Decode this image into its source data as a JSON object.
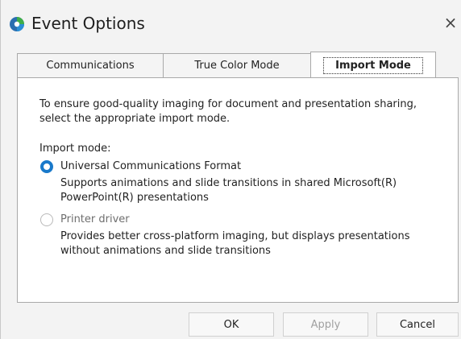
{
  "window": {
    "title": "Event Options",
    "close_glyph": "×"
  },
  "tabs": [
    {
      "label": "Communications",
      "active": false
    },
    {
      "label": "True Color Mode",
      "active": false
    },
    {
      "label": "Import Mode",
      "active": true
    }
  ],
  "panel": {
    "intro": "To ensure good-quality imaging for document and presentation sharing, select the appropriate import mode.",
    "import_mode_label": "Import mode:",
    "options": [
      {
        "label": "Universal Communications Format",
        "description": "Supports animations and slide transitions in shared Microsoft(R) PowerPoint(R) presentations",
        "selected": true
      },
      {
        "label": "Printer driver",
        "description": "Provides better cross-platform imaging, but displays presentations without animations and slide transitions",
        "selected": false
      }
    ]
  },
  "buttons": {
    "ok": "OK",
    "apply": "Apply",
    "cancel": "Cancel"
  },
  "colors": {
    "accent": "#1979ca",
    "dialog_bg": "#f3f3f3",
    "panel_bg": "#ffffff"
  }
}
